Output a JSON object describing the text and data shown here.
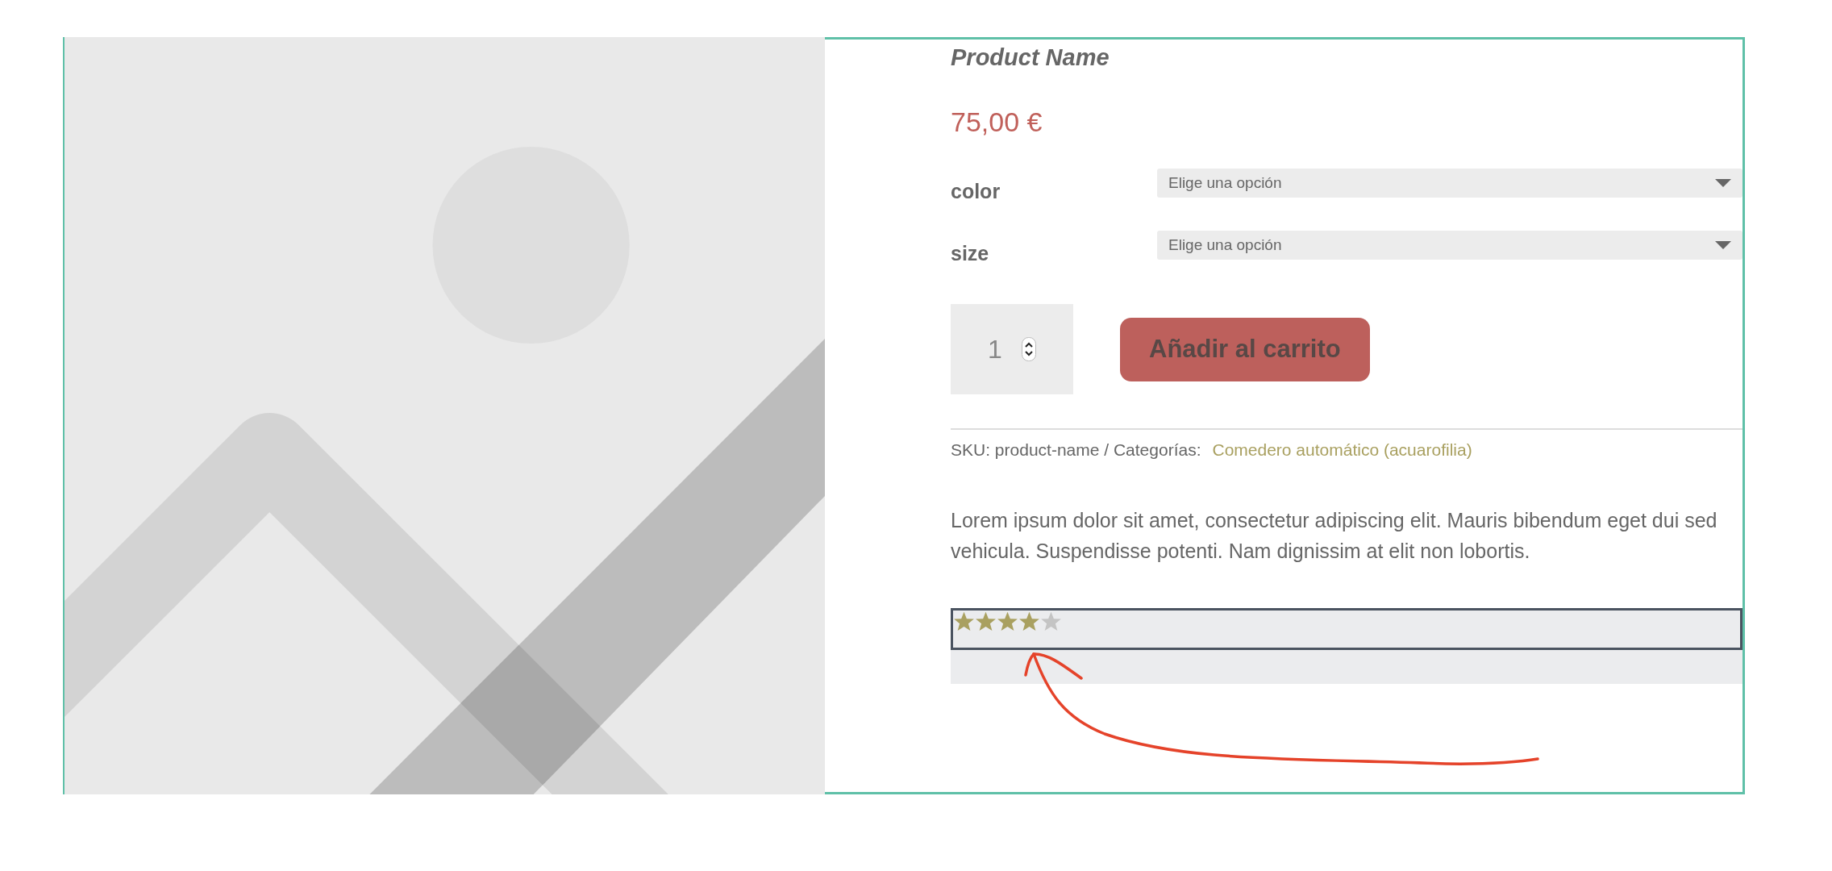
{
  "product": {
    "kind": "picture",
    "title": "Product Name",
    "price": "75,00 €"
  },
  "attributes": [
    {
      "label": "color",
      "value": "Elige una opción"
    },
    {
      "label": "size",
      "value": "Elige una opción"
    }
  ],
  "quantity": {
    "value": "1"
  },
  "add_to_cart": {
    "label": "Añadir al carrito"
  },
  "meta": {
    "sku": "SKU: product-name / Categorías:",
    "category": "Comedero automático (acuarofilia)"
  },
  "description": "Lorem ipsum dolor sit amet, consectetur adipiscing elit. Mauris bibendum eget dui sed vehicula. Suspendisse potenti. Nam dignissim at elit non lobortis.",
  "rating": {
    "stars": 4
  }
}
